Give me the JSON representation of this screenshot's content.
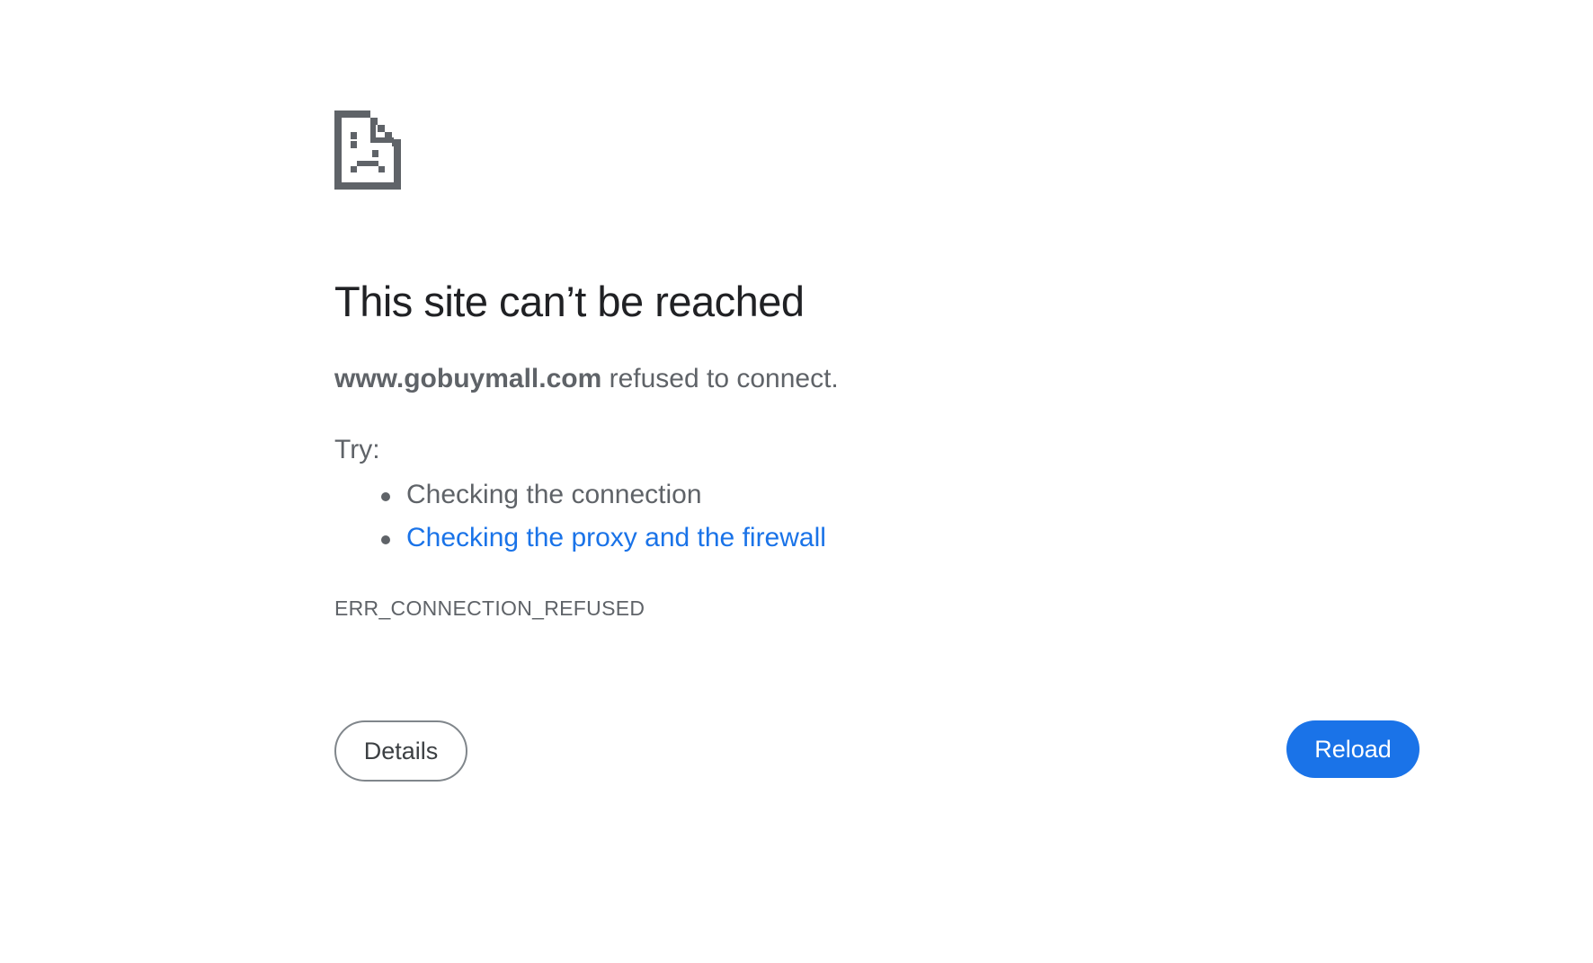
{
  "error_page": {
    "icon": "sad-document-icon",
    "title": "This site can’t be reached",
    "host": "www.gobuymall.com",
    "summary_rest": " refused to connect.",
    "try_label": "Try:",
    "suggestions": [
      {
        "label": "Checking the connection",
        "is_link": false
      },
      {
        "label": "Checking the proxy and the firewall",
        "is_link": true
      }
    ],
    "error_code": "ERR_CONNECTION_REFUSED",
    "details_button": "Details",
    "reload_button": "Reload"
  },
  "colors": {
    "title": "#202124",
    "body_text": "#5f6368",
    "link": "#1a73e8",
    "primary_button": "#1a73e8",
    "secondary_button_border": "#80868b"
  }
}
